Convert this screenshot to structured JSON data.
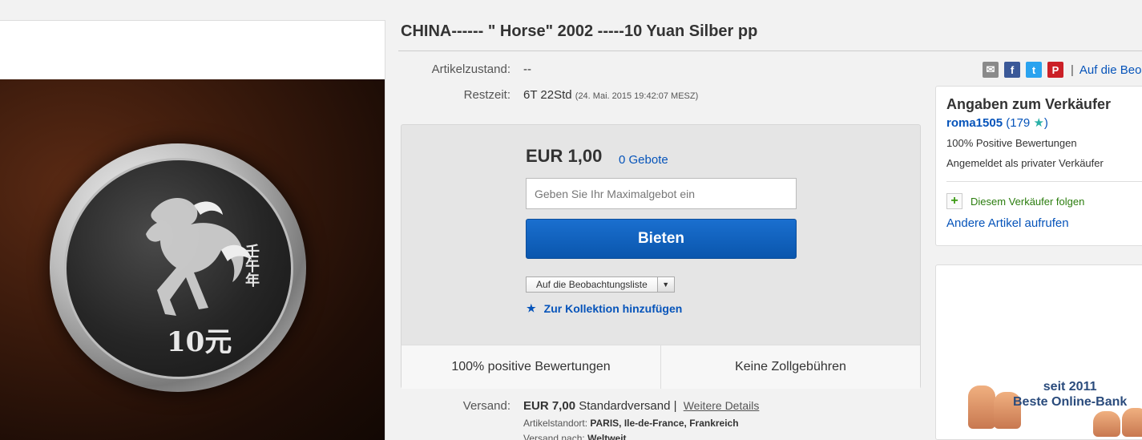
{
  "listing": {
    "title": "CHINA------ \" Horse\" 2002 -----10 Yuan Silber pp",
    "condition_label": "Artikelzustand:",
    "condition_value": "--",
    "time_label": "Restzeit:",
    "time_value": "6T 22Std",
    "time_end": "(24. Mai. 2015   19:42:07 MESZ)"
  },
  "coin": {
    "value_text": "10元",
    "side_text": "壬午年"
  },
  "share": {
    "icons": [
      "mail-icon",
      "facebook-icon",
      "twitter-icon",
      "pinterest-icon"
    ],
    "separator": "|",
    "watch_link": "Auf die Beo"
  },
  "bid": {
    "price": "EUR 1,00",
    "bids": "0 Gebote",
    "input_placeholder": "Geben Sie Ihr Maximalgebot ein",
    "button": "Bieten",
    "watch_select": "Auf die Beobachtungsliste",
    "collection": "Zur Kollektion hinzufügen",
    "footer_left": "100% positive Bewertungen",
    "footer_right": "Keine Zollgebühren"
  },
  "shipping": {
    "label": "Versand:",
    "cost": "EUR 7,00",
    "method": "Standardversand |",
    "details_link": "Weitere Details",
    "location_label": "Artikelstandort:",
    "location_value": "PARIS, Ile-de-France, Frankreich",
    "ship_to_label": "Versand nach:",
    "ship_to_value": "Weltweit"
  },
  "seller": {
    "heading": "Angaben zum Verkäufer",
    "name": "roma1505",
    "feedback_open": "(179",
    "feedback_star": "★",
    "feedback_close": ")",
    "positive": "100% Positive Bewertungen",
    "registered": "Angemeldet als privater Verkäufer",
    "follow": "Diesem Verkäufer folgen",
    "other_items": "Andere Artikel aufrufen"
  },
  "ad": {
    "line1": "seit 2011",
    "line2": "Beste Online-Bank"
  },
  "colors": {
    "link": "#0654ba",
    "button": "#0a56ad",
    "follow_green": "#2b7d0e",
    "star_teal": "#2ab0a7"
  }
}
